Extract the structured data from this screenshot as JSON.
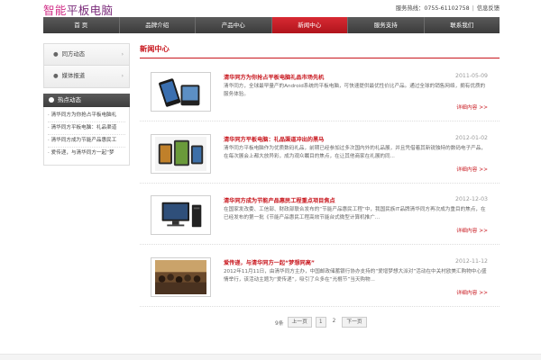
{
  "header": {
    "logo_part1": "智能",
    "logo_part2": "平板电脑",
    "hotline": "服务热线：0755-61102758",
    "feedback": "信息反馈"
  },
  "nav": {
    "items": [
      {
        "label": "首 页"
      },
      {
        "label": "品牌介绍"
      },
      {
        "label": "产品中心"
      },
      {
        "label": "新闻中心"
      },
      {
        "label": "服务支持"
      },
      {
        "label": "联系我们"
      }
    ],
    "active_index": 3,
    "active_color": "#c8161d"
  },
  "sidebar": {
    "menu": [
      {
        "label": "同方动态"
      },
      {
        "label": "媒体报道"
      }
    ],
    "hot_title": "热点动态",
    "hot_items": [
      "清华同方为你抢占平板电脑礼",
      "清华同方平板电脑：礼品渠道",
      "清华同方成为节能产品惠民工",
      "爱传递，与清华同方一起“梦"
    ]
  },
  "main": {
    "title": "新闻中心",
    "articles": [
      {
        "title": "清华同方为你抢占平板电脑礼品市场先机",
        "date": "2011-05-09",
        "summary": "清华同方，全球最早量产的Android系统的平板电脑，可快速提供最优性价比产品。通过全球的销售网络，拥有优质的服务体验。",
        "more": "详细内容 >>",
        "thumb": "phone-device-image"
      },
      {
        "title": "清华同方平板电脑：礼品渠道冲出的黑马",
        "date": "2012-01-02",
        "summary": "清华同方平板电脑作为优质数码礼品，前期已经参加过多次国内外的礼品展，并且凭借着其新锐独特的数码电子产品，在每次展会上都大放异彩，成为观众瞩目的焦点，在让其他商家在礼展的同...",
        "more": "详细内容 >>",
        "thumb": "tablet-devices-image"
      },
      {
        "title": "清华同方成为节能产品惠民工程重点项目焦点",
        "date": "2012-12-03",
        "summary": "在国家发改委、工信部、财政部联合发布的“节能产品惠民工程”中，我国民族IT品牌清华同方再次成为重目的焦点，在已经发布的第一批《节能产品惠民工程高效节能台式微型计算机推广...",
        "more": "详细内容 >>",
        "thumb": "desktop-computer-image"
      },
      {
        "title": "爱传递，与清华同方一起“梦想同高”",
        "date": "2012-11-12",
        "summary": "2012年11月11日，由清华同方主办，中国邮政储蓄银行协办支持的“爱增梦想大派对”活动在中关村欧美汇购物中心盛情举行，该活动主题为“爱传递”，吸引了众多在“光棍节”当天购物...",
        "more": "详细内容 >>",
        "thumb": "event-crowd-image"
      }
    ]
  },
  "pager": {
    "count": "9条",
    "prev": "上一页",
    "pages": [
      "1",
      "2"
    ],
    "current": "2",
    "next": "下一页"
  }
}
